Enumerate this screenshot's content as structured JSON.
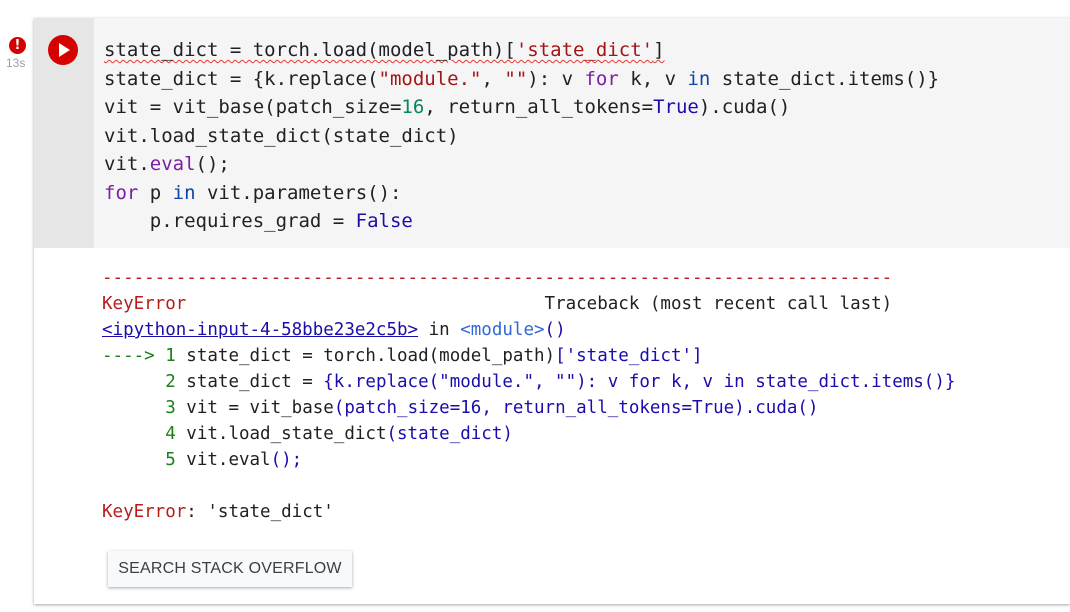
{
  "status": {
    "error_mark": "!",
    "exec_time": "13s"
  },
  "code": {
    "line1_a": "state_dict = torch.load(model_path)[",
    "line1_str": "'state_dict'",
    "line1_b": "]",
    "line2_a": "state_dict = {k.replace(",
    "line2_s1": "\"module.\"",
    "line2_b": ", ",
    "line2_s2": "\"\"",
    "line2_c": "): v ",
    "line2_for": "for",
    "line2_d": " k, v ",
    "line2_in": "in",
    "line2_e": " state_dict.items()}",
    "line3_a": "vit = vit_base(patch_size=",
    "line3_num": "16",
    "line3_b": ", return_all_tokens=",
    "line3_true": "True",
    "line3_c": ").cuda()",
    "line4": "vit.load_state_dict(state_dict)",
    "line5_a": "vit.",
    "line5_eval": "eval",
    "line5_b": "();",
    "line6_for": "for",
    "line6_a": " p ",
    "line6_in": "in",
    "line6_b": " vit.parameters():",
    "line7_a": "    p.requires_grad = ",
    "line7_false": "False"
  },
  "output": {
    "dashes": "---------------------------------------------------------------------------",
    "error_name": "KeyError",
    "traceback_gap": "                                  ",
    "traceback_label": "Traceback (most recent call last)",
    "input_link": "<ipython-input-4-58bbe23e2c5b>",
    "in_word": " in ",
    "module": "<module>",
    "module_paren": "()",
    "arrow": "---->",
    "l1_no": " 1 ",
    "l1_a": "state_dict = torch.load(model_path)",
    "l1_b": "['state_dict']",
    "l2_no": "      2 ",
    "l2_a": "state_dict = ",
    "l2_b": "{k.replace(\"module.\", \"\"): v for k, v in state_dict.items()}",
    "l3_no": "      3 ",
    "l3_a": "vit = vit_base",
    "l3_b": "(patch_size=16, return_all_tokens=True).cuda()",
    "l4_no": "      4 ",
    "l4_a": "vit.load_state_dict",
    "l4_b": "(state_dict)",
    "l5_no": "      5 ",
    "l5_a": "vit.eval",
    "l5_b": "();",
    "final_name": "KeyError",
    "final_msg": ": 'state_dict'"
  },
  "search_button": {
    "label": "SEARCH STACK OVERFLOW"
  },
  "colors": {
    "run_button": "#d50000",
    "error_text": "#b71c1c",
    "keyword": "#7b1fa2",
    "string": "#a31515",
    "number": "#098658"
  }
}
